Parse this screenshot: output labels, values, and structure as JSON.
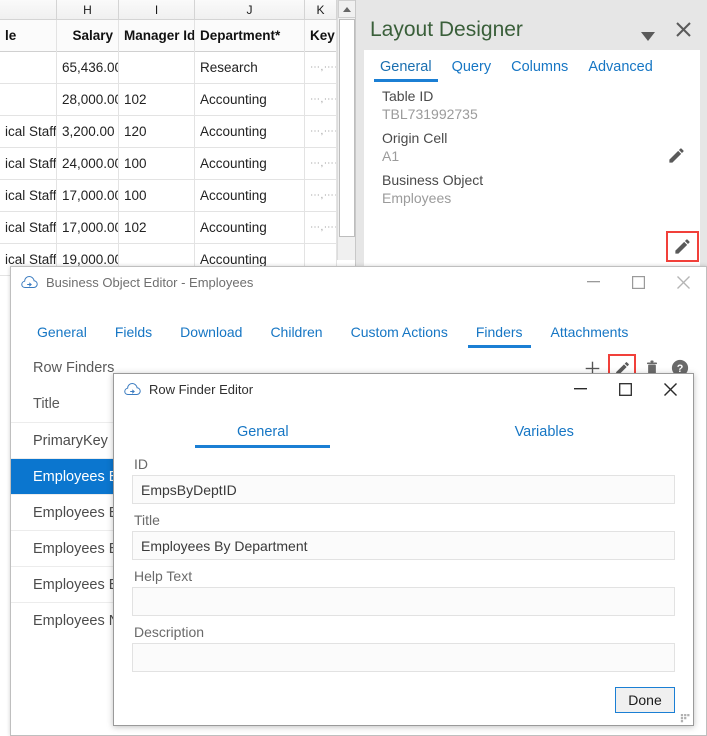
{
  "spreadsheet": {
    "column_letters": [
      "H",
      "I",
      "J",
      "K"
    ],
    "headers": [
      "le",
      "Salary",
      "Manager Id",
      "Department*",
      "Key"
    ],
    "rows": [
      {
        "title": "",
        "salary": "65,436.00",
        "manager_id": "",
        "department": "Research",
        "key": "⋯,⋯⋯"
      },
      {
        "title": "",
        "salary": "28,000.00",
        "manager_id": "102",
        "department": "Accounting",
        "key": "⋯,⋯⋯"
      },
      {
        "title": "ical Staff",
        "salary": "3,200.00",
        "manager_id": "120",
        "department": "Accounting",
        "key": "⋯,⋯⋯"
      },
      {
        "title": "ical Staff",
        "salary": "24,000.00",
        "manager_id": "100",
        "department": "Accounting",
        "key": "⋯,⋯⋯"
      },
      {
        "title": "ical Staff",
        "salary": "17,000.00",
        "manager_id": "100",
        "department": "Accounting",
        "key": "⋯,⋯⋯"
      },
      {
        "title": "ical Staff",
        "salary": "17,000.00",
        "manager_id": "102",
        "department": "Accounting",
        "key": "⋯,⋯⋯"
      },
      {
        "title": "ical Staff",
        "salary": "19,000.00",
        "manager_id": "",
        "department": "Accounting",
        "key": ""
      }
    ]
  },
  "layout_designer": {
    "title": "Layout Designer",
    "caret_icon": "chevron-down-icon",
    "close_icon": "close-icon",
    "tabs": [
      {
        "label": "General",
        "active": true
      },
      {
        "label": "Query",
        "active": false
      },
      {
        "label": "Columns",
        "active": false
      },
      {
        "label": "Advanced",
        "active": false
      }
    ],
    "fields": [
      {
        "label": "Table ID",
        "value": "TBL731992735",
        "has_edit": false
      },
      {
        "label": "Origin Cell",
        "value": "A1",
        "has_edit": true
      },
      {
        "label": "Business Object",
        "value": "Employees",
        "has_edit": true
      }
    ],
    "highlight_color": "#f1403a"
  },
  "business_object_editor": {
    "window_title": "Business Object Editor - Employees",
    "app_icon": "cloud-arrow-icon",
    "window_buttons": {
      "minimize": "—",
      "maximize": "☐",
      "close": "✕"
    },
    "tabs": [
      {
        "label": "General",
        "active": false
      },
      {
        "label": "Fields",
        "active": false
      },
      {
        "label": "Download",
        "active": false
      },
      {
        "label": "Children",
        "active": false
      },
      {
        "label": "Custom Actions",
        "active": false
      },
      {
        "label": "Finders",
        "active": true
      },
      {
        "label": "Attachments",
        "active": false
      }
    ],
    "section_label": "Row Finders",
    "actions": [
      {
        "name": "add-finder-button",
        "glyph": "+",
        "highlighted": false
      },
      {
        "name": "edit-finder-button",
        "glyph": "pencil",
        "highlighted": true
      },
      {
        "name": "delete-finder-button",
        "glyph": "trash",
        "highlighted": false
      },
      {
        "name": "help-button",
        "glyph": "?",
        "highlighted": false
      }
    ],
    "list_header": "Title",
    "finders": [
      {
        "label": "PrimaryKey",
        "selected": false
      },
      {
        "label": "Employees By",
        "selected": true
      },
      {
        "label": "Employees By",
        "selected": false
      },
      {
        "label": "Employees By",
        "selected": false
      },
      {
        "label": "Employees By",
        "selected": false
      },
      {
        "label": "Employees Na",
        "selected": false
      }
    ]
  },
  "row_finder_editor": {
    "window_title": "Row Finder Editor",
    "app_icon": "cloud-arrow-icon",
    "window_buttons": {
      "minimize": "—",
      "maximize": "☐",
      "close": "✕"
    },
    "tabs": [
      {
        "label": "General",
        "active": true
      },
      {
        "label": "Variables",
        "active": false
      }
    ],
    "fields": [
      {
        "label": "ID",
        "value": "EmpsByDeptID",
        "placeholder": ""
      },
      {
        "label": "Title",
        "value": "Employees By Department",
        "placeholder": ""
      },
      {
        "label": "Help Text",
        "value": "",
        "placeholder": ""
      },
      {
        "label": "Description",
        "value": "",
        "placeholder": ""
      }
    ],
    "done_label": "Done"
  },
  "colors": {
    "accent_blue": "#1b7fd4",
    "link_blue": "#1676c4",
    "selection_blue": "#0b76cf",
    "highlight_red": "#f1403a",
    "panel_grey": "#e6e6e6",
    "designer_title_green": "#3a5f3a"
  }
}
